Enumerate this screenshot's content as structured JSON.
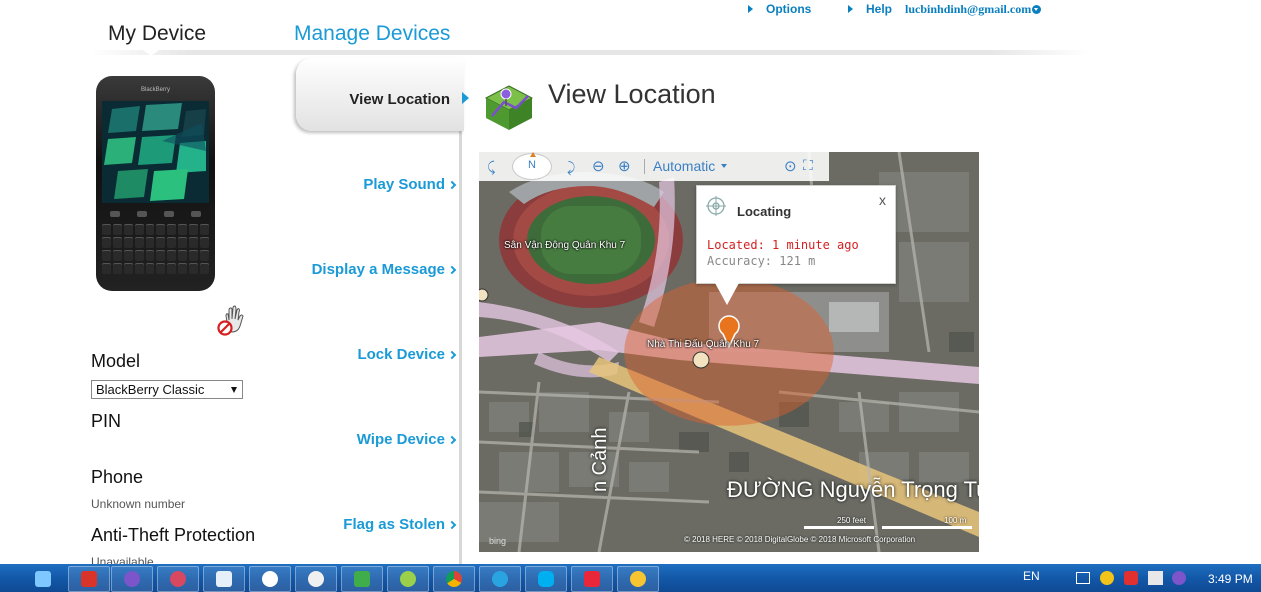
{
  "toplinks": {
    "options": "Options",
    "help": "Help",
    "email": "lucbinhdinh@gmail.com"
  },
  "tabs": {
    "my_device": "My Device",
    "manage_devices": "Manage Devices"
  },
  "device": {
    "brand": "BlackBerry",
    "model_label": "Model",
    "model_value": "BlackBerry Classic",
    "pin_label": "PIN",
    "phone_label": "Phone",
    "phone_value": "Unknown number",
    "anti_theft_label": "Anti-Theft Protection",
    "anti_theft_value": "Unavailable"
  },
  "menu": {
    "view_location": "View Location",
    "play_sound": "Play Sound",
    "display_message": "Display a Message",
    "lock_device": "Lock Device",
    "wipe_device": "Wipe Device",
    "flag_stolen": "Flag as Stolen"
  },
  "view": {
    "title": "View Location"
  },
  "map": {
    "toolbar": {
      "north": "N",
      "imagery": "Automatic"
    },
    "popup": {
      "title": "Locating",
      "close": "x",
      "located": "Located: 1 minute ago",
      "accuracy": "Accuracy: 121 m"
    },
    "labels": {
      "stadium": "Sân Vận Động Quân Khu 7",
      "gym": "Nhà Thi Đấu Quân Khu 7",
      "street": "ĐƯỜNG Nguyễn Trọng Tu",
      "street2": "n Cảnh"
    },
    "scale": {
      "feet": "250 feet",
      "meters": "100 m"
    },
    "copyright": "© 2018 HERE   © 2018 DigitalGlobe   © 2018 Microsoft Corporation",
    "bing": "bing"
  },
  "taskbar": {
    "lang": "EN",
    "clock": "3:49 PM"
  },
  "colors": {
    "accent_blue": "#1a9ad6",
    "accuracy_circle": "#e0602a",
    "located_red": "#d42020",
    "taskbar": "#1358a8"
  }
}
